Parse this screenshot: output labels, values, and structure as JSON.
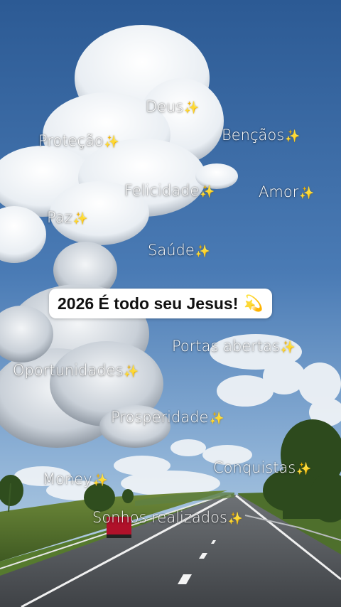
{
  "banner": {
    "text": "2026 É todo seu Jesus!",
    "emoji": "💫"
  },
  "spark": "✨",
  "words": {
    "deus": "Deus",
    "protecao": "Proteção",
    "bencaos": "Bençãos",
    "felicidade": "Felicidade",
    "amor": "Amor",
    "paz": "Paz",
    "saude": "Saúde",
    "portas": "Portas abertas",
    "oportunidades": "Oportunidades",
    "prosperidade": "Prosperidade",
    "conquistas": "Conquistas",
    "money": "Money",
    "sonhos": "Sonhos realizados"
  },
  "colors": {
    "sky_top": "#2f5f9a",
    "sky_bottom": "#a9c6e2",
    "spark": "#ffd84a"
  }
}
